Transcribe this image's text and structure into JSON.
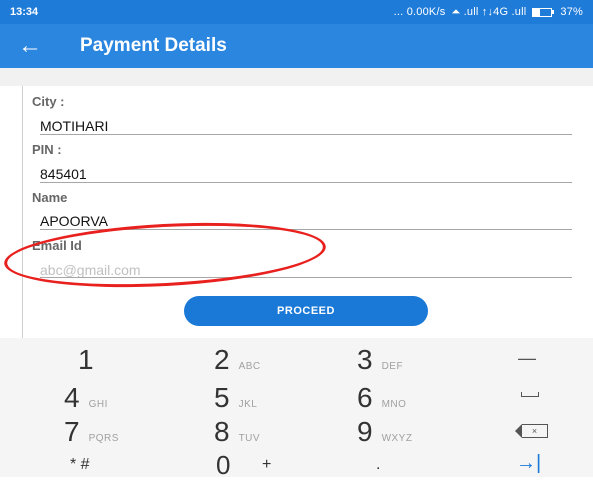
{
  "status_bar": {
    "time": "13:34",
    "network_speed": "... 0.00K/s",
    "network_icons": "⏶ .ull ↑↓4G .ull",
    "battery_percent": "37%",
    "battery_level": 0.37
  },
  "app_bar": {
    "back_icon": "←",
    "title": "Payment Details"
  },
  "form": {
    "city": {
      "label": "City :",
      "value": "MOTIHARI"
    },
    "pin": {
      "label": "PIN :",
      "value": "845401"
    },
    "name": {
      "label": "Name",
      "value": "APOORVA"
    },
    "email": {
      "label": "Email Id",
      "placeholder": "abc@gmail.com"
    }
  },
  "proceed_button": {
    "label": "PROCEED"
  },
  "annotation": {
    "color": "#e8201e"
  },
  "keyboard": {
    "rows": [
      [
        {
          "digit": "1",
          "letters": ""
        },
        {
          "digit": "2",
          "letters": "ABC"
        },
        {
          "digit": "3",
          "letters": "DEF"
        }
      ],
      [
        {
          "digit": "4",
          "letters": "GHI"
        },
        {
          "digit": "5",
          "letters": "JKL"
        },
        {
          "digit": "6",
          "letters": "MNO"
        }
      ],
      [
        {
          "digit": "7",
          "letters": "PQRS"
        },
        {
          "digit": "8",
          "letters": "TUV"
        },
        {
          "digit": "9",
          "letters": "WXYZ"
        }
      ]
    ],
    "bottom": {
      "star_hash": "* #",
      "zero": "0",
      "plus": "+",
      "dot": "."
    },
    "fn_keys": {
      "minus": "—",
      "space_icon": "space-icon",
      "delete_icon": "backspace-icon",
      "next": "→|"
    }
  },
  "colors": {
    "primary": "#2b86e0",
    "status_bar": "#1f7bd8",
    "button": "#1a78d6"
  }
}
